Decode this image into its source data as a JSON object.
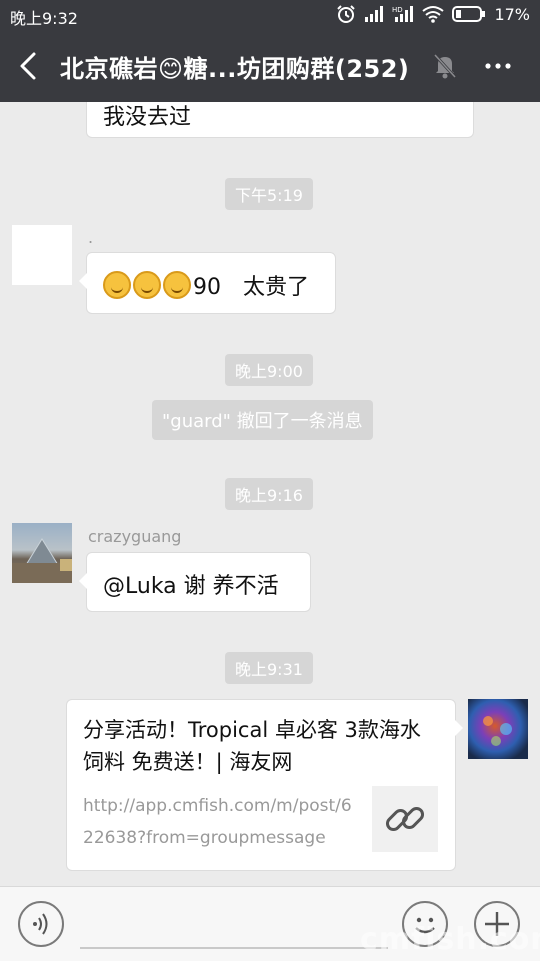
{
  "status": {
    "time": "晚上9:32",
    "battery": "17%",
    "icons": [
      "alarm-icon",
      "signal-icon",
      "hd-signal-icon",
      "wifi-icon",
      "battery-icon"
    ]
  },
  "header": {
    "title": "北京礁岩😊糖...坊团购群(252)",
    "back_icon": "back-arrow-icon",
    "mute_icon": "muted-bell-icon",
    "more_icon": "more-icon"
  },
  "messages": {
    "m0": {
      "text": "我没去过"
    },
    "t1": "下午5:19",
    "m1": {
      "sender": ".",
      "text": "90　太贵了",
      "emoji_count": 3
    },
    "t2": "晚上9:00",
    "sys1": "\"guard\" 撤回了一条消息",
    "t3": "晚上9:16",
    "m2": {
      "sender": "crazyguang",
      "text": "@Luka 谢  养不活"
    },
    "t4": "晚上9:31",
    "link": {
      "title": "分享活动！Tropical 卓必客 3款海水饲料 免费送！| 海友网",
      "url": "http://app.cmfish.com/m/post/622638?from=groupmessage",
      "thumb_icon": "link-icon"
    }
  },
  "input": {
    "voice_icon": "voice-icon",
    "emoji_icon": "emoji-icon",
    "add_icon": "add-icon"
  },
  "watermark": "cmfish.com",
  "colors": {
    "header_bg": "#393a3f",
    "chat_bg": "#ebebeb",
    "bubble_bg": "#ffffff",
    "pill_bg": "#d6d6d6"
  }
}
